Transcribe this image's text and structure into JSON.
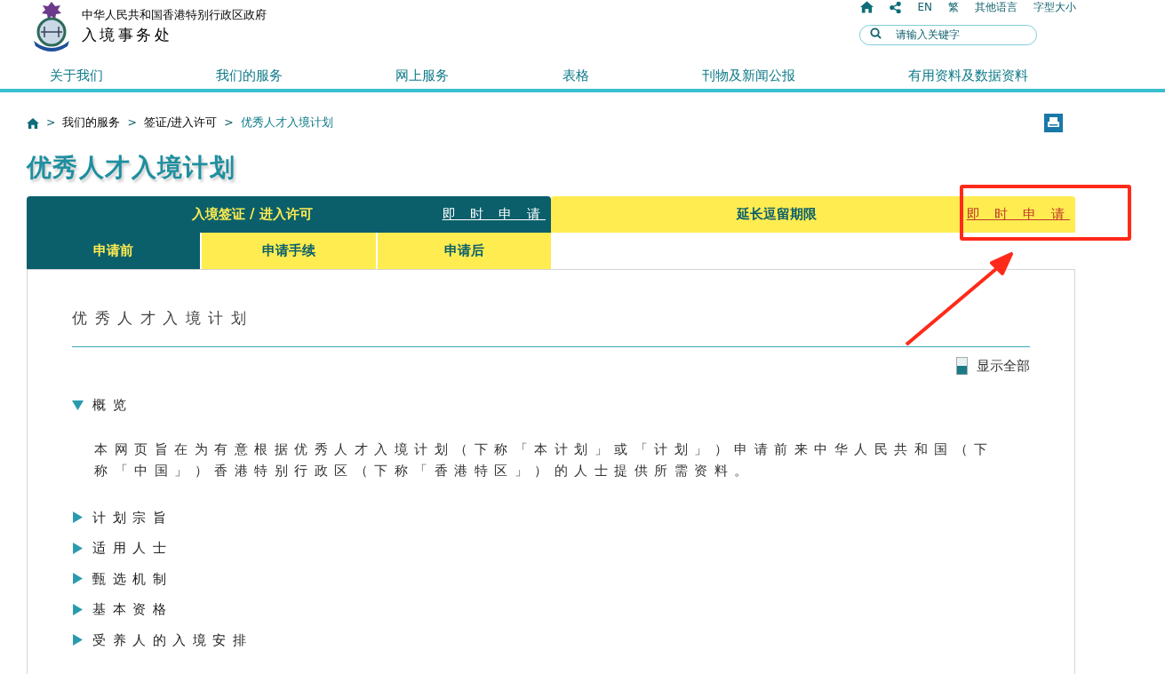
{
  "header": {
    "gov_name": "中华人民共和国香港特别行政区政府",
    "dept_name": "入境事务处",
    "utility_links": [
      "EN",
      "繁",
      "其他语言",
      "字型大小"
    ],
    "search": {
      "placeholder": "请输入关键字"
    }
  },
  "nav": [
    "关于我们",
    "我们的服务",
    "网上服务",
    "表格",
    "刊物及新闻公报",
    "有用资料及数据资料"
  ],
  "breadcrumb": {
    "separator": ">",
    "items": [
      "我们的服务",
      "签证/进入许可",
      "优秀人才入境计划"
    ]
  },
  "page_title": "优秀人才入境计划",
  "groups": [
    {
      "label": "入境签证 / 进入许可",
      "link": "即 时 申 请",
      "selected": true
    },
    {
      "label": "延长逗留期限",
      "link": "即 时 申 请",
      "selected": false
    }
  ],
  "subtabs": [
    {
      "label": "申请前",
      "selected": true
    },
    {
      "label": "申请手续",
      "selected": false
    },
    {
      "label": "申请后",
      "selected": false
    }
  ],
  "content": {
    "heading": "优秀人才入境计划",
    "show_all": "显示全部",
    "sections": [
      {
        "title": "概览",
        "expanded": true,
        "body": "本网页旨在为有意根据优秀人才入境计划（下称「本计划」或「计划」）申请前来中华人民共和国（下称「中国」）香港特别行政区（下称「香港特区」）的人士提供所需资料。"
      },
      {
        "title": "计划宗旨",
        "expanded": false
      },
      {
        "title": "适用人士",
        "expanded": false
      },
      {
        "title": "甄选机制",
        "expanded": false
      },
      {
        "title": "基本资格",
        "expanded": false
      },
      {
        "title": "受养人的入境安排",
        "expanded": false
      }
    ]
  }
}
